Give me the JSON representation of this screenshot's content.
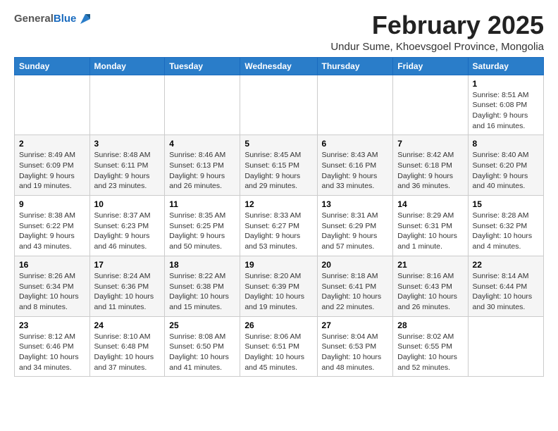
{
  "header": {
    "logo_general": "General",
    "logo_blue": "Blue",
    "month_title": "February 2025",
    "subtitle": "Undur Sume, Khoevsgoel Province, Mongolia"
  },
  "weekdays": [
    "Sunday",
    "Monday",
    "Tuesday",
    "Wednesday",
    "Thursday",
    "Friday",
    "Saturday"
  ],
  "weeks": [
    [
      {
        "day": "",
        "info": ""
      },
      {
        "day": "",
        "info": ""
      },
      {
        "day": "",
        "info": ""
      },
      {
        "day": "",
        "info": ""
      },
      {
        "day": "",
        "info": ""
      },
      {
        "day": "",
        "info": ""
      },
      {
        "day": "1",
        "info": "Sunrise: 8:51 AM\nSunset: 6:08 PM\nDaylight: 9 hours and 16 minutes."
      }
    ],
    [
      {
        "day": "2",
        "info": "Sunrise: 8:49 AM\nSunset: 6:09 PM\nDaylight: 9 hours and 19 minutes."
      },
      {
        "day": "3",
        "info": "Sunrise: 8:48 AM\nSunset: 6:11 PM\nDaylight: 9 hours and 23 minutes."
      },
      {
        "day": "4",
        "info": "Sunrise: 8:46 AM\nSunset: 6:13 PM\nDaylight: 9 hours and 26 minutes."
      },
      {
        "day": "5",
        "info": "Sunrise: 8:45 AM\nSunset: 6:15 PM\nDaylight: 9 hours and 29 minutes."
      },
      {
        "day": "6",
        "info": "Sunrise: 8:43 AM\nSunset: 6:16 PM\nDaylight: 9 hours and 33 minutes."
      },
      {
        "day": "7",
        "info": "Sunrise: 8:42 AM\nSunset: 6:18 PM\nDaylight: 9 hours and 36 minutes."
      },
      {
        "day": "8",
        "info": "Sunrise: 8:40 AM\nSunset: 6:20 PM\nDaylight: 9 hours and 40 minutes."
      }
    ],
    [
      {
        "day": "9",
        "info": "Sunrise: 8:38 AM\nSunset: 6:22 PM\nDaylight: 9 hours and 43 minutes."
      },
      {
        "day": "10",
        "info": "Sunrise: 8:37 AM\nSunset: 6:23 PM\nDaylight: 9 hours and 46 minutes."
      },
      {
        "day": "11",
        "info": "Sunrise: 8:35 AM\nSunset: 6:25 PM\nDaylight: 9 hours and 50 minutes."
      },
      {
        "day": "12",
        "info": "Sunrise: 8:33 AM\nSunset: 6:27 PM\nDaylight: 9 hours and 53 minutes."
      },
      {
        "day": "13",
        "info": "Sunrise: 8:31 AM\nSunset: 6:29 PM\nDaylight: 9 hours and 57 minutes."
      },
      {
        "day": "14",
        "info": "Sunrise: 8:29 AM\nSunset: 6:31 PM\nDaylight: 10 hours and 1 minute."
      },
      {
        "day": "15",
        "info": "Sunrise: 8:28 AM\nSunset: 6:32 PM\nDaylight: 10 hours and 4 minutes."
      }
    ],
    [
      {
        "day": "16",
        "info": "Sunrise: 8:26 AM\nSunset: 6:34 PM\nDaylight: 10 hours and 8 minutes."
      },
      {
        "day": "17",
        "info": "Sunrise: 8:24 AM\nSunset: 6:36 PM\nDaylight: 10 hours and 11 minutes."
      },
      {
        "day": "18",
        "info": "Sunrise: 8:22 AM\nSunset: 6:38 PM\nDaylight: 10 hours and 15 minutes."
      },
      {
        "day": "19",
        "info": "Sunrise: 8:20 AM\nSunset: 6:39 PM\nDaylight: 10 hours and 19 minutes."
      },
      {
        "day": "20",
        "info": "Sunrise: 8:18 AM\nSunset: 6:41 PM\nDaylight: 10 hours and 22 minutes."
      },
      {
        "day": "21",
        "info": "Sunrise: 8:16 AM\nSunset: 6:43 PM\nDaylight: 10 hours and 26 minutes."
      },
      {
        "day": "22",
        "info": "Sunrise: 8:14 AM\nSunset: 6:44 PM\nDaylight: 10 hours and 30 minutes."
      }
    ],
    [
      {
        "day": "23",
        "info": "Sunrise: 8:12 AM\nSunset: 6:46 PM\nDaylight: 10 hours and 34 minutes."
      },
      {
        "day": "24",
        "info": "Sunrise: 8:10 AM\nSunset: 6:48 PM\nDaylight: 10 hours and 37 minutes."
      },
      {
        "day": "25",
        "info": "Sunrise: 8:08 AM\nSunset: 6:50 PM\nDaylight: 10 hours and 41 minutes."
      },
      {
        "day": "26",
        "info": "Sunrise: 8:06 AM\nSunset: 6:51 PM\nDaylight: 10 hours and 45 minutes."
      },
      {
        "day": "27",
        "info": "Sunrise: 8:04 AM\nSunset: 6:53 PM\nDaylight: 10 hours and 48 minutes."
      },
      {
        "day": "28",
        "info": "Sunrise: 8:02 AM\nSunset: 6:55 PM\nDaylight: 10 hours and 52 minutes."
      },
      {
        "day": "",
        "info": ""
      }
    ]
  ]
}
